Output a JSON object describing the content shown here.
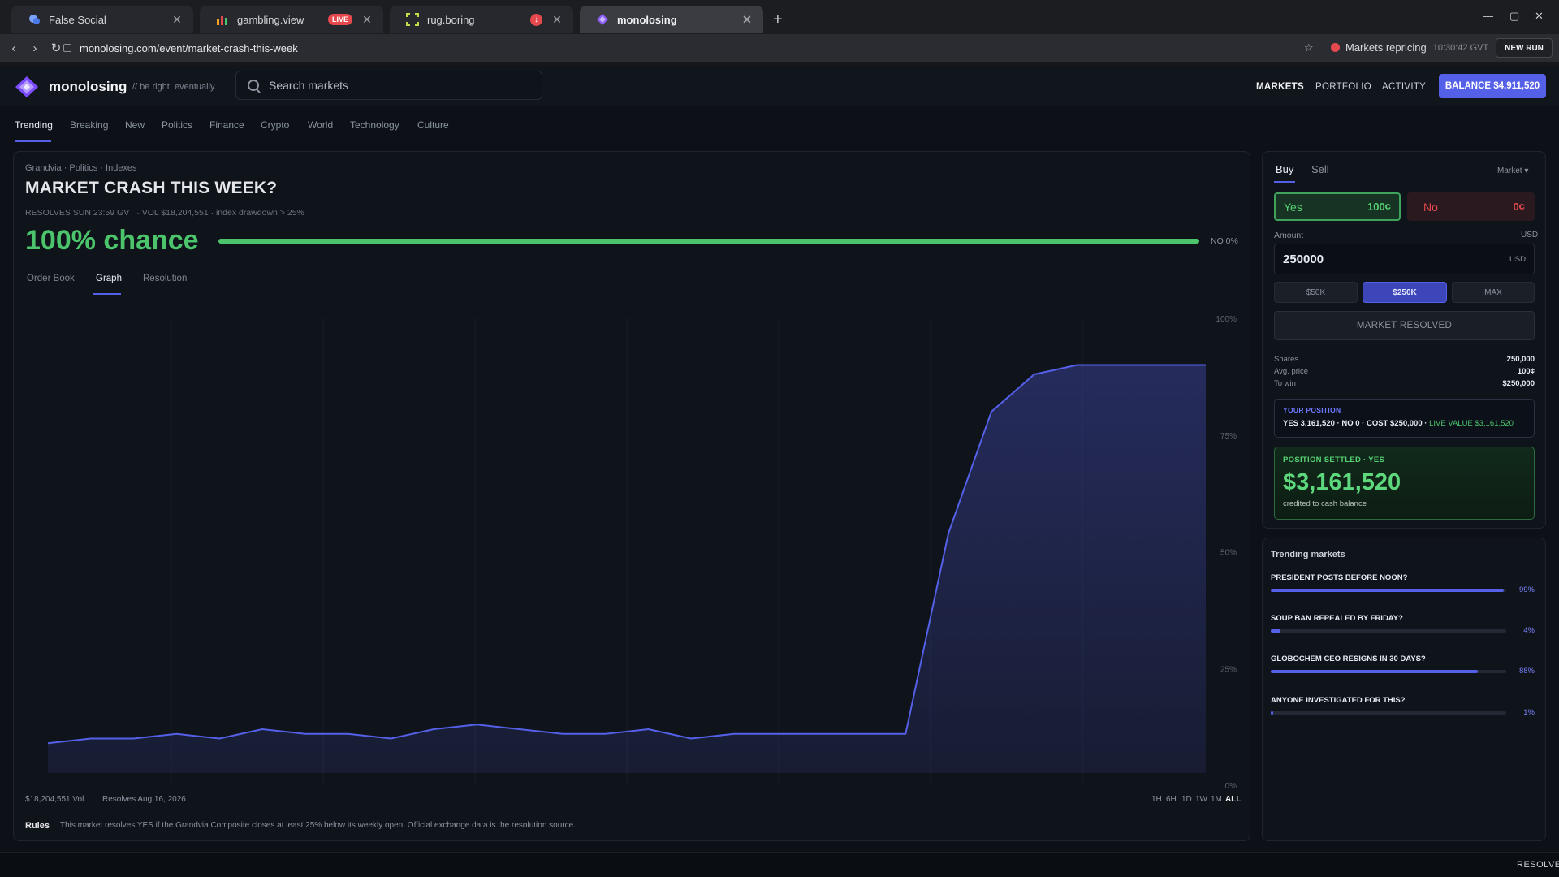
{
  "browser": {
    "tabs": [
      {
        "title": "False Social",
        "icon": "social-bubble-icon"
      },
      {
        "title": "gambling.view",
        "icon": "bar-chart-icon",
        "badge": "LIVE"
      },
      {
        "title": "rug.boring",
        "icon": "frame-icon",
        "badge": "download"
      },
      {
        "title": "monolosing",
        "icon": "monolosing-logo-icon",
        "active": true
      }
    ],
    "url": "monolosing.com/event/market-crash-this-week",
    "status": {
      "label": "Markets repricing",
      "time": "10:30:42 GVT",
      "dot_color": "#e5484d"
    },
    "new_run": "NEW RUN"
  },
  "app": {
    "brand": "monolosing",
    "tagline": "// be right. eventually.",
    "search_placeholder": "Search markets",
    "nav": [
      "MARKETS",
      "PORTFOLIO",
      "ACTIVITY"
    ],
    "balance": "BALANCE $4,911,520",
    "accent": "#5560e8"
  },
  "categories": [
    "Trending",
    "Breaking",
    "New",
    "Politics",
    "Finance",
    "Crypto",
    "World",
    "Technology",
    "Culture"
  ],
  "market": {
    "breadcrumb": "Grandvia · Politics · Indexes",
    "title": "MARKET CRASH THIS WEEK?",
    "meta": "RESOLVES SUN 23:59 GVT · VOL $18,204,551 · index drawdown > 25%",
    "chance": "100% chance",
    "chance_value": 1.0,
    "no_label": "NO 0%",
    "tabs": [
      "Order Book",
      "Graph",
      "Resolution"
    ],
    "footer_vol": "$18,204,551 Vol.",
    "footer_resolves": "Resolves Aug 16, 2026",
    "ranges": [
      "1H",
      "6H",
      "1D",
      "1W",
      "1M",
      "ALL"
    ],
    "rules_label": "Rules",
    "rules_text": "This market resolves YES if the Grandvia Composite closes at least 25% below its weekly open. Official exchange data is the resolution source."
  },
  "chart_data": {
    "type": "area",
    "y_ticks": [
      "100%",
      "75%",
      "50%",
      "25%",
      "0%"
    ],
    "ylim": [
      0,
      100
    ],
    "values": [
      9,
      10,
      10,
      11,
      10,
      12,
      11,
      11,
      10,
      12,
      13,
      12,
      11,
      11,
      12,
      10,
      11,
      11,
      11,
      11,
      11,
      54,
      80,
      88,
      90,
      90,
      90,
      90
    ],
    "grid": true,
    "color": "#5560e8"
  },
  "trade": {
    "tabs": [
      "Buy",
      "Sell"
    ],
    "order_type": "Market ▾",
    "yes_label": "Yes",
    "yes_price": "100¢",
    "no_label": "No",
    "no_price": "0¢",
    "amount_label": "Amount",
    "amount_currency": "USD",
    "amount_value": "250000",
    "amount_unit": "USD",
    "quick": [
      "$50K",
      "$250K",
      "MAX"
    ],
    "submit": "MARKET RESOLVED",
    "summary": [
      {
        "k": "Shares",
        "v": "250,000"
      },
      {
        "k": "Avg. price",
        "v": "100¢"
      },
      {
        "k": "To win",
        "v": "$250,000"
      }
    ],
    "position_header": "YOUR POSITION",
    "position_body": "YES 3,161,520 · NO 0 · COST $250,000 · ",
    "position_live": "LIVE VALUE $3,161,520",
    "settled_header": "POSITION SETTLED · YES",
    "settled_amount": "$3,161,520",
    "settled_sub": "credited to cash balance"
  },
  "trending": {
    "header": "Trending markets",
    "items": [
      {
        "q": "PRESIDENT POSTS BEFORE NOON?",
        "pct": "99%",
        "value": 0.99
      },
      {
        "q": "SOUP BAN REPEALED BY FRIDAY?",
        "pct": "4%",
        "value": 0.04
      },
      {
        "q": "GLOBOCHEM CEO RESIGNS IN 30 DAYS?",
        "pct": "88%",
        "value": 0.88
      },
      {
        "q": "ANYONE INVESTIGATED FOR THIS?",
        "pct": "1%",
        "value": 0.01
      }
    ]
  },
  "statusbar": "RESOLVED"
}
